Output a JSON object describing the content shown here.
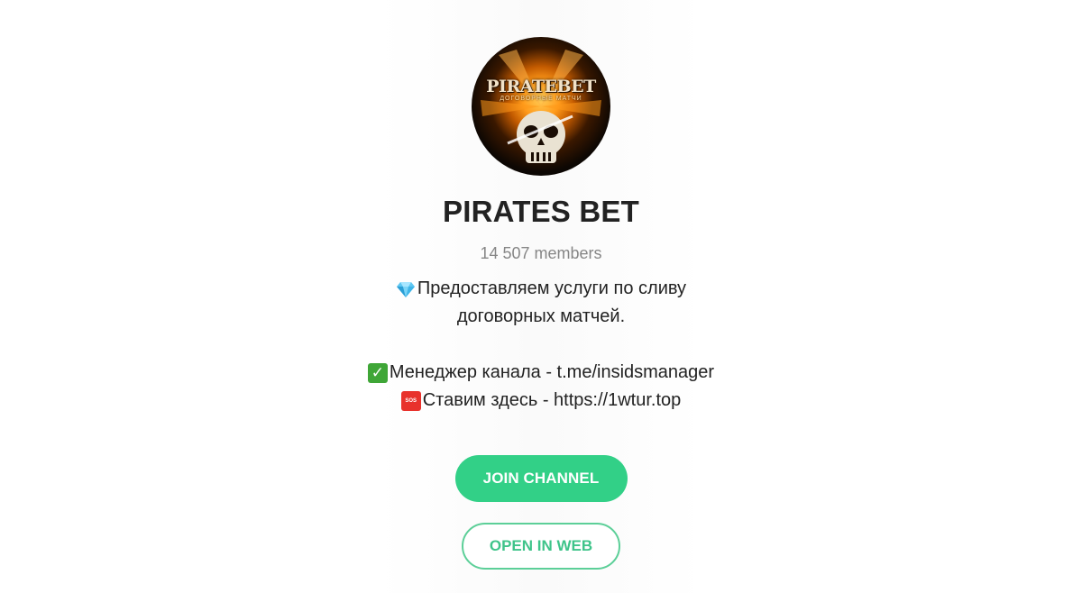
{
  "channel": {
    "avatar_logo_text": "PIRATEBET",
    "avatar_logo_subtitle": "ДОГОВОРНЫЕ МАТЧИ",
    "title": "PIRATES BET",
    "members": "14 507 members"
  },
  "description": {
    "line1": "Предоставляем услуги по сливу",
    "line2": "договорных матчей.",
    "line3": "Менеджер канала - t.me/insidsmanager",
    "line4": "Ставим здесь - https://1wtur.top",
    "emoji1": "gem-stone-emoji",
    "emoji2": "check-mark-emoji",
    "emoji3": "sos-emoji"
  },
  "buttons": {
    "join": "JOIN CHANNEL",
    "open_web": "OPEN IN WEB"
  },
  "colors": {
    "accent": "#32d087",
    "title": "#222222",
    "muted": "#868686"
  }
}
